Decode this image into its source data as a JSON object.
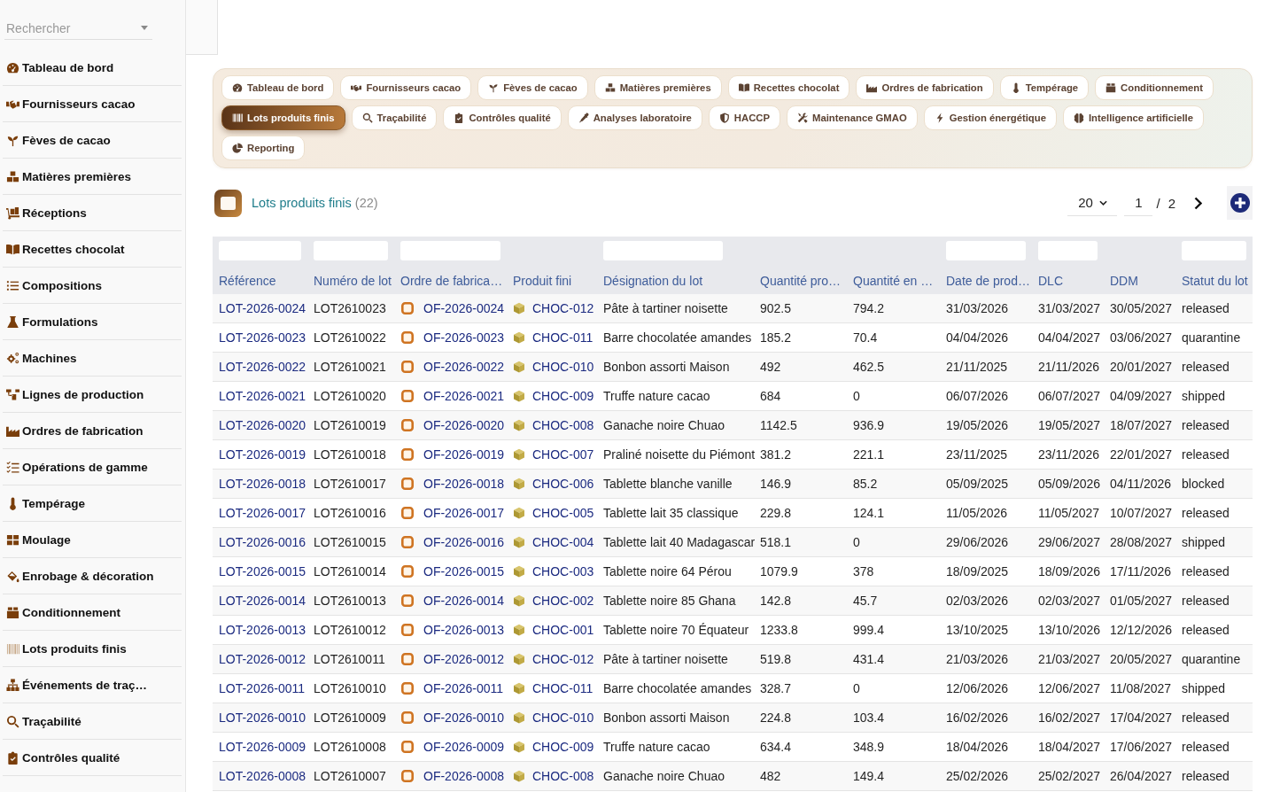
{
  "sidebar": {
    "search": {
      "placeholder": "Rechercher"
    },
    "items": [
      {
        "label": "Tableau de bord"
      },
      {
        "label": "Fournisseurs cacao"
      },
      {
        "label": "Fèves de cacao"
      },
      {
        "label": "Matières premières"
      },
      {
        "label": "Réceptions"
      },
      {
        "label": "Recettes chocolat"
      },
      {
        "label": "Compositions"
      },
      {
        "label": "Formulations"
      },
      {
        "label": "Machines"
      },
      {
        "label": "Lignes de production"
      },
      {
        "label": "Ordres de fabrication"
      },
      {
        "label": "Opérations de gamme"
      },
      {
        "label": "Tempérage"
      },
      {
        "label": "Moulage"
      },
      {
        "label": "Enrobage & décoration"
      },
      {
        "label": "Conditionnement"
      },
      {
        "label": "Lots produits finis"
      },
      {
        "label": "Événements de traç…"
      },
      {
        "label": "Traçabilité"
      },
      {
        "label": "Contrôles qualité"
      }
    ]
  },
  "modules": {
    "tabs": [
      {
        "label": "Tableau de bord",
        "selected": false
      },
      {
        "label": "Fournisseurs cacao",
        "selected": false
      },
      {
        "label": "Fèves de cacao",
        "selected": false
      },
      {
        "label": "Matières premières",
        "selected": false
      },
      {
        "label": "Recettes chocolat",
        "selected": false
      },
      {
        "label": "Ordres de fabrication",
        "selected": false
      },
      {
        "label": "Tempérage",
        "selected": false
      },
      {
        "label": "Conditionnement",
        "selected": false
      },
      {
        "label": "Lots produits finis",
        "selected": true
      },
      {
        "label": "Traçabilité",
        "selected": false
      },
      {
        "label": "Contrôles qualité",
        "selected": false
      },
      {
        "label": "Analyses laboratoire",
        "selected": false
      },
      {
        "label": "HACCP",
        "selected": false
      },
      {
        "label": "Maintenance GMAO",
        "selected": false
      },
      {
        "label": "Gestion énergétique",
        "selected": false
      },
      {
        "label": "Intelligence artificielle",
        "selected": false
      },
      {
        "label": "Reporting",
        "selected": false
      }
    ]
  },
  "list": {
    "title": "Lots produits finis",
    "count": "(22)",
    "page_size": "20",
    "page": "1",
    "separator": "/",
    "page_count": "2"
  },
  "table": {
    "columns": [
      {
        "label": "Référence",
        "kind": "link",
        "filter": true
      },
      {
        "label": "Numéro de lot",
        "kind": "text",
        "filter": true
      },
      {
        "label": "Ordre de fabrica…",
        "kind": "order",
        "filter": true
      },
      {
        "label": "Produit fini",
        "kind": "product",
        "filter": false
      },
      {
        "label": "Désignation du lot",
        "kind": "text",
        "filter": true
      },
      {
        "label": "Quantité pro…",
        "kind": "text",
        "filter": false
      },
      {
        "label": "Quantité en …",
        "kind": "text",
        "filter": false
      },
      {
        "label": "Date de prod…",
        "kind": "text",
        "filter": true
      },
      {
        "label": "DLC",
        "kind": "text",
        "filter": true
      },
      {
        "label": "DDM",
        "kind": "text",
        "filter": false
      },
      {
        "label": "Statut du lot",
        "kind": "text",
        "filter": true
      }
    ],
    "rows": [
      {
        "cells": [
          "LOT-2026-0024",
          "LOT2610023",
          "OF-2026-0024",
          "CHOC-012",
          "Pâte à tartiner noisette",
          "902.5",
          "794.2",
          "31/03/2026",
          "31/03/2027",
          "30/05/2027",
          "released"
        ]
      },
      {
        "cells": [
          "LOT-2026-0023",
          "LOT2610022",
          "OF-2026-0023",
          "CHOC-011",
          "Barre chocolatée amandes",
          "185.2",
          "70.4",
          "04/04/2026",
          "04/04/2027",
          "03/06/2027",
          "quarantine"
        ]
      },
      {
        "cells": [
          "LOT-2026-0022",
          "LOT2610021",
          "OF-2026-0022",
          "CHOC-010",
          "Bonbon assorti Maison",
          "492",
          "462.5",
          "21/11/2025",
          "21/11/2026",
          "20/01/2027",
          "released"
        ]
      },
      {
        "cells": [
          "LOT-2026-0021",
          "LOT2610020",
          "OF-2026-0021",
          "CHOC-009",
          "Truffe nature cacao",
          "684",
          "0",
          "06/07/2026",
          "06/07/2027",
          "04/09/2027",
          "shipped"
        ]
      },
      {
        "cells": [
          "LOT-2026-0020",
          "LOT2610019",
          "OF-2026-0020",
          "CHOC-008",
          "Ganache noire Chuao",
          "1142.5",
          "936.9",
          "19/05/2026",
          "19/05/2027",
          "18/07/2027",
          "released"
        ]
      },
      {
        "cells": [
          "LOT-2026-0019",
          "LOT2610018",
          "OF-2026-0019",
          "CHOC-007",
          "Praliné noisette du Piémont",
          "381.2",
          "221.1",
          "23/11/2025",
          "23/11/2026",
          "22/01/2027",
          "released"
        ]
      },
      {
        "cells": [
          "LOT-2026-0018",
          "LOT2610017",
          "OF-2026-0018",
          "CHOC-006",
          "Tablette blanche vanille",
          "146.9",
          "85.2",
          "05/09/2025",
          "05/09/2026",
          "04/11/2026",
          "blocked"
        ]
      },
      {
        "cells": [
          "LOT-2026-0017",
          "LOT2610016",
          "OF-2026-0017",
          "CHOC-005",
          "Tablette lait 35 classique",
          "229.8",
          "124.1",
          "11/05/2026",
          "11/05/2027",
          "10/07/2027",
          "released"
        ]
      },
      {
        "cells": [
          "LOT-2026-0016",
          "LOT2610015",
          "OF-2026-0016",
          "CHOC-004",
          "Tablette lait 40 Madagascar",
          "518.1",
          "0",
          "29/06/2026",
          "29/06/2027",
          "28/08/2027",
          "shipped"
        ]
      },
      {
        "cells": [
          "LOT-2026-0015",
          "LOT2610014",
          "OF-2026-0015",
          "CHOC-003",
          "Tablette noire 64 Pérou",
          "1079.9",
          "378",
          "18/09/2025",
          "18/09/2026",
          "17/11/2026",
          "released"
        ]
      },
      {
        "cells": [
          "LOT-2026-0014",
          "LOT2610013",
          "OF-2026-0014",
          "CHOC-002",
          "Tablette noire 85 Ghana",
          "142.8",
          "45.7",
          "02/03/2026",
          "02/03/2027",
          "01/05/2027",
          "released"
        ]
      },
      {
        "cells": [
          "LOT-2026-0013",
          "LOT2610012",
          "OF-2026-0013",
          "CHOC-001",
          "Tablette noire 70 Équateur",
          "1233.8",
          "999.4",
          "13/10/2025",
          "13/10/2026",
          "12/12/2026",
          "released"
        ]
      },
      {
        "cells": [
          "LOT-2026-0012",
          "LOT2610011",
          "OF-2026-0012",
          "CHOC-012",
          "Pâte à tartiner noisette",
          "519.8",
          "431.4",
          "21/03/2026",
          "21/03/2027",
          "20/05/2027",
          "quarantine"
        ]
      },
      {
        "cells": [
          "LOT-2026-0011",
          "LOT2610010",
          "OF-2026-0011",
          "CHOC-011",
          "Barre chocolatée amandes",
          "328.7",
          "0",
          "12/06/2026",
          "12/06/2027",
          "11/08/2027",
          "shipped"
        ]
      },
      {
        "cells": [
          "LOT-2026-0010",
          "LOT2610009",
          "OF-2026-0010",
          "CHOC-010",
          "Bonbon assorti Maison",
          "224.8",
          "103.4",
          "16/02/2026",
          "16/02/2027",
          "17/04/2027",
          "released"
        ]
      },
      {
        "cells": [
          "LOT-2026-0009",
          "LOT2610008",
          "OF-2026-0009",
          "CHOC-009",
          "Truffe nature cacao",
          "634.4",
          "348.9",
          "18/04/2026",
          "18/04/2027",
          "17/06/2027",
          "released"
        ]
      },
      {
        "cells": [
          "LOT-2026-0008",
          "LOT2610007",
          "OF-2026-0008",
          "CHOC-008",
          "Ganache noire Chuao",
          "482",
          "149.4",
          "25/02/2026",
          "25/02/2027",
          "26/04/2027",
          "released"
        ]
      }
    ]
  }
}
